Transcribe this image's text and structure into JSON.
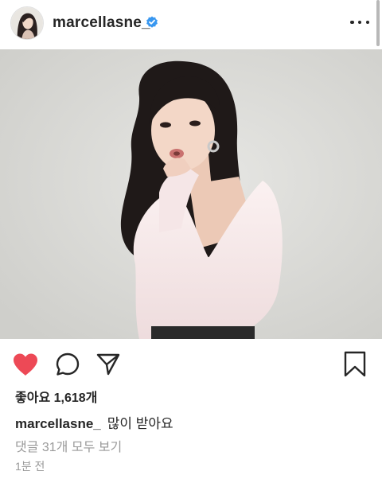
{
  "header": {
    "username": "marcellasne_",
    "verified_color": "#3897f0",
    "avatar_icon": "profile-avatar",
    "more_icon": "more-horizontal-icon"
  },
  "post": {
    "photo_description_icon": "portrait-photo"
  },
  "actions": {
    "like_icon": "heart-icon",
    "like_color": "#ed4956",
    "liked": true,
    "comment_icon": "comment-icon",
    "share_icon": "direct-share-icon",
    "save_icon": "bookmark-icon"
  },
  "likes_text": "좋아요 1,618개",
  "caption": {
    "username": "marcellasne_",
    "text": "많이 받아요"
  },
  "comments_link": "댓글 31개 모두 보기",
  "timestamp": "1분 전"
}
